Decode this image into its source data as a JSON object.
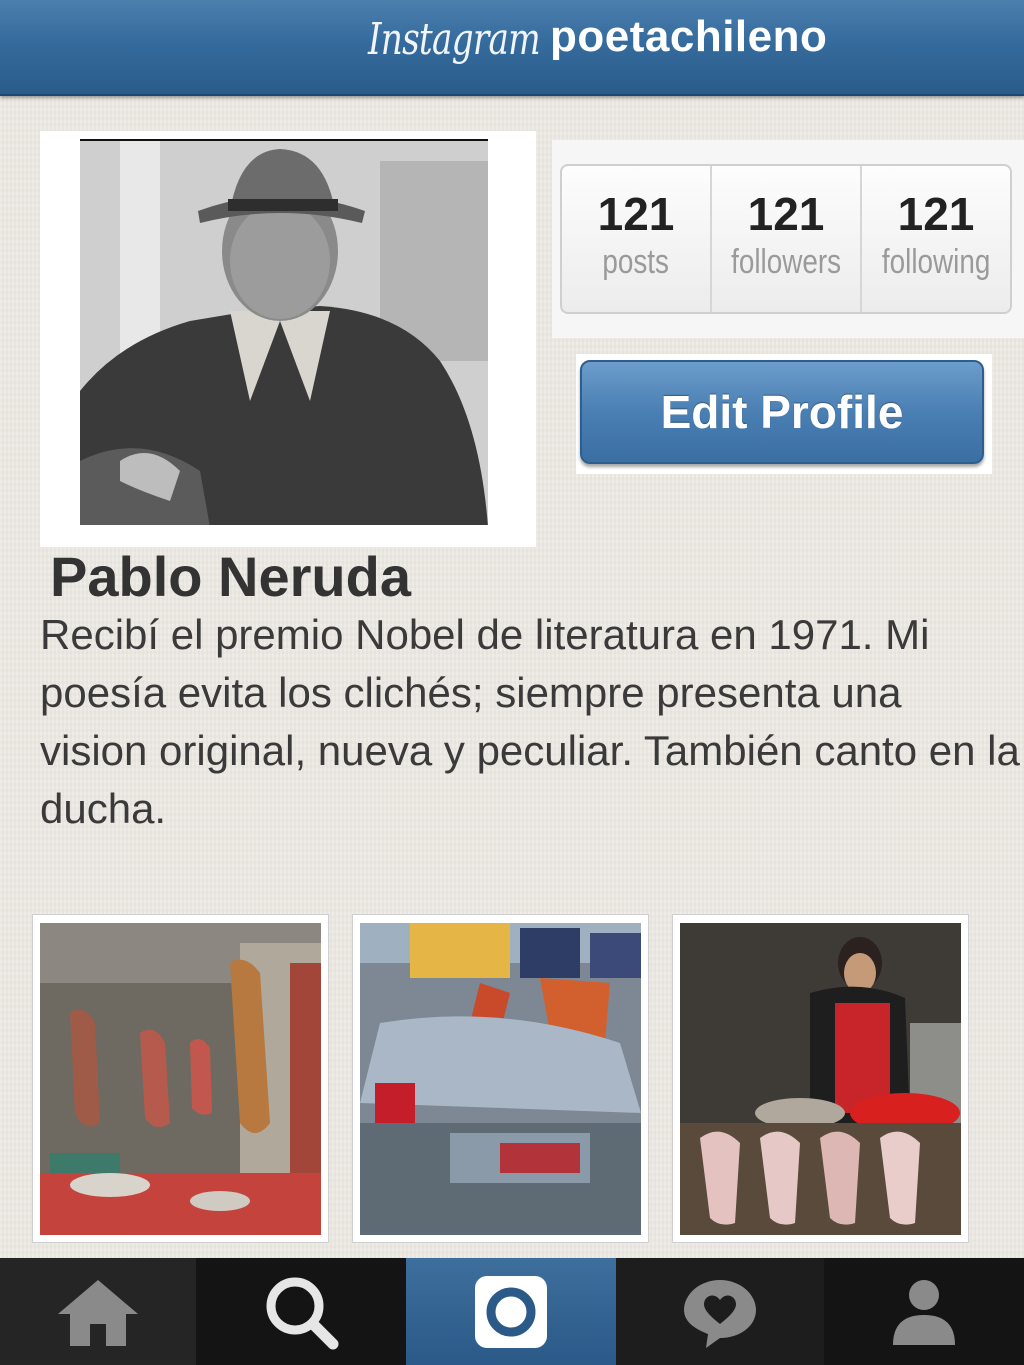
{
  "header": {
    "logo": "Instagram",
    "username": "poetachileno"
  },
  "stats": [
    {
      "value": "121",
      "label": "posts"
    },
    {
      "value": "121",
      "label": "followers"
    },
    {
      "value": "121",
      "label": "following"
    }
  ],
  "edit_profile_label": "Edit Profile",
  "profile": {
    "name": "Pablo Neruda",
    "bio": "Recibí el premio Nobel de literatura en 1971. Mi poesía evita los clichés; siempre presenta una vision original, nueva y peculiar. También canto en la ducha."
  },
  "tabbar": {
    "icons": [
      "home-icon",
      "search-icon",
      "camera-icon",
      "activity-heart-icon",
      "profile-icon"
    ],
    "active_color": "#356b9d"
  },
  "colors": {
    "header": "#356b9d",
    "button": "#4a7fb3"
  }
}
